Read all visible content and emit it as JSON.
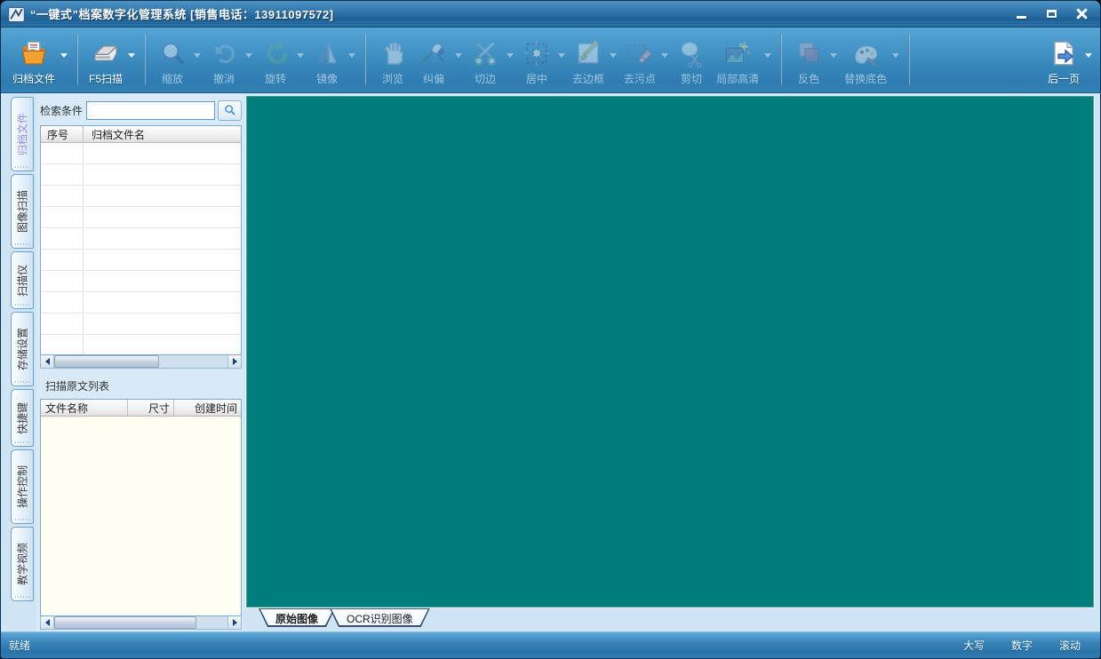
{
  "window": {
    "title": "“一键式”档案数字化管理系统  [销售电话：13911097572]",
    "controls": [
      {
        "name": "minimize",
        "icon": "minimize-icon"
      },
      {
        "name": "maximize",
        "icon": "maximize-icon"
      },
      {
        "name": "close",
        "icon": "close-icon"
      }
    ]
  },
  "toolbar": {
    "items": [
      {
        "label": "归档文件",
        "icon": "archive-folder-icon",
        "enabled": true,
        "arrow": true,
        "sep_after": true
      },
      {
        "label": "F5扫描",
        "icon": "scanner-icon",
        "enabled": true,
        "arrow": true,
        "sep_after": true
      },
      {
        "label": "缩放",
        "icon": "zoom-icon",
        "enabled": false,
        "arrow": true,
        "sep_after": false
      },
      {
        "label": "撤消",
        "icon": "undo-icon",
        "enabled": false,
        "arrow": true,
        "sep_after": false
      },
      {
        "label": "旋转",
        "icon": "rotate-icon",
        "enabled": false,
        "arrow": true,
        "sep_after": false
      },
      {
        "label": "镜像",
        "icon": "mirror-icon",
        "enabled": false,
        "arrow": true,
        "sep_after": true
      },
      {
        "label": "浏览",
        "icon": "browse-hand-icon",
        "enabled": false,
        "arrow": false,
        "sep_after": false
      },
      {
        "label": "纠偏",
        "icon": "deskew-pen-icon",
        "enabled": false,
        "arrow": true,
        "sep_after": false
      },
      {
        "label": "切边",
        "icon": "trim-scissors-icon",
        "enabled": false,
        "arrow": true,
        "sep_after": false
      },
      {
        "label": "居中",
        "icon": "center-icon",
        "enabled": false,
        "arrow": true,
        "sep_after": false
      },
      {
        "label": "去边框",
        "icon": "remove-border-icon",
        "enabled": false,
        "arrow": true,
        "sep_after": false
      },
      {
        "label": "去污点",
        "icon": "remove-stain-icon",
        "enabled": false,
        "arrow": true,
        "sep_after": false
      },
      {
        "label": "剪切",
        "icon": "cut-icon",
        "enabled": false,
        "arrow": false,
        "sep_after": false
      },
      {
        "label": "局部高清",
        "icon": "local-hd-icon",
        "enabled": false,
        "arrow": true,
        "sep_after": true
      },
      {
        "label": "反色",
        "icon": "invert-color-icon",
        "enabled": false,
        "arrow": true,
        "sep_after": false
      },
      {
        "label": "替换底色",
        "icon": "replace-bg-icon",
        "enabled": false,
        "arrow": true,
        "sep_after": true
      },
      {
        "label": "后一页",
        "icon": "next-page-icon",
        "enabled": true,
        "arrow": true,
        "sep_after": false
      }
    ]
  },
  "sidebar": {
    "tabs": [
      {
        "label": "归档文件",
        "active": true
      },
      {
        "label": "图像扫描",
        "active": false
      },
      {
        "label": "扫描仪",
        "active": false
      },
      {
        "label": "存储设置",
        "active": false
      },
      {
        "label": "快捷键",
        "active": false
      },
      {
        "label": "操作控制",
        "active": false
      },
      {
        "label": "教学视频",
        "active": false
      }
    ]
  },
  "left_panel": {
    "search": {
      "label": "检索条件",
      "value": "",
      "button_icon": "search-icon"
    },
    "archive_table": {
      "columns": [
        "序号",
        "归档文件名"
      ],
      "rows": []
    },
    "scan_list": {
      "label": "扫描原文列表",
      "columns": [
        "文件名称",
        "尺寸",
        "创建时间"
      ],
      "rows": []
    }
  },
  "doc_tabs": {
    "tabs": [
      {
        "label": "原始图像",
        "active": true
      },
      {
        "label": "OCR识别图像",
        "active": false
      }
    ]
  },
  "status_bar": {
    "ready": "就绪",
    "indicators": [
      "大写",
      "数字",
      "滚动"
    ]
  },
  "colors": {
    "canvas_teal": "#007E7E",
    "titlebar_blue": "#2E74A9",
    "toolbar_blue": "#3A89BD",
    "panel_light_blue": "#D8EAF8",
    "scan_list_ivory": "#FFFEF2"
  }
}
